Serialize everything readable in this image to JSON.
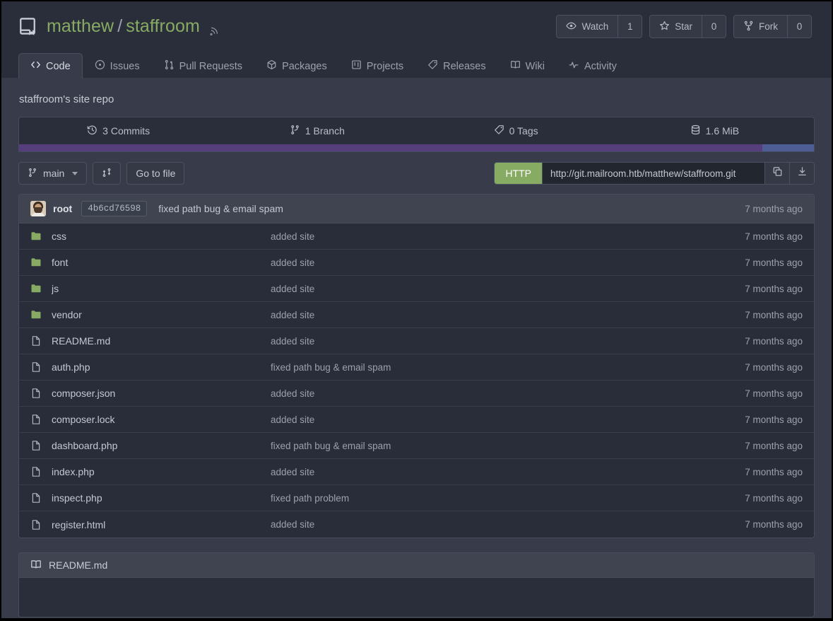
{
  "header": {
    "repo_icon": "repo-book-icon",
    "owner": "matthew",
    "separator": "/",
    "name": "staffroom",
    "rss_icon": "rss-icon",
    "actions": [
      {
        "icon": "eye-icon",
        "label": "Watch",
        "count": "1"
      },
      {
        "icon": "star-icon",
        "label": "Star",
        "count": "0"
      },
      {
        "icon": "fork-icon",
        "label": "Fork",
        "count": "0"
      }
    ]
  },
  "tabs": [
    {
      "id": "code",
      "label": "Code",
      "icon": "code-icon",
      "active": true
    },
    {
      "id": "issues",
      "label": "Issues",
      "icon": "issue-circle-icon",
      "active": false
    },
    {
      "id": "pull-requests",
      "label": "Pull Requests",
      "icon": "git-pull-request-icon",
      "active": false
    },
    {
      "id": "packages",
      "label": "Packages",
      "icon": "package-cube-icon",
      "active": false
    },
    {
      "id": "projects",
      "label": "Projects",
      "icon": "project-board-icon",
      "active": false
    },
    {
      "id": "releases",
      "label": "Releases",
      "icon": "tag-icon",
      "active": false
    },
    {
      "id": "wiki",
      "label": "Wiki",
      "icon": "book-icon",
      "active": false
    },
    {
      "id": "activity",
      "label": "Activity",
      "icon": "pulse-icon",
      "active": false
    }
  ],
  "description": "staffroom's site repo",
  "stats": [
    {
      "icon": "history-clock-icon",
      "label": "3 Commits"
    },
    {
      "icon": "branch-icon",
      "label": "1 Branch"
    },
    {
      "icon": "tag-icon",
      "label": "0 Tags"
    },
    {
      "icon": "database-icon",
      "label": "1.6 MiB"
    }
  ],
  "language_bar": [
    {
      "name": "primary-language",
      "color": "#563d7c",
      "percent": 93.5
    },
    {
      "name": "secondary-language",
      "color": "#4f5d95",
      "percent": 6.5
    }
  ],
  "toolbar": {
    "branch_icon": "branch-icon",
    "branch_label": "main",
    "compare_icon": "git-compare-icon",
    "go_to_file_label": "Go to file",
    "clone": {
      "protocol_label": "HTTP",
      "protocol_color": "#87ab63",
      "url": "http://git.mailroom.htb/matthew/staffroom.git",
      "copy_icon": "copy-icon",
      "download_icon": "download-icon"
    }
  },
  "latest_commit": {
    "avatar": "user-avatar",
    "author": "root",
    "sha": "4b6cd76598",
    "message": "fixed path bug & email spam",
    "age": "7 months ago"
  },
  "files": [
    {
      "type": "folder",
      "icon": "folder-icon",
      "name": "css",
      "message": "added site",
      "age": "7 months ago"
    },
    {
      "type": "folder",
      "icon": "folder-icon",
      "name": "font",
      "message": "added site",
      "age": "7 months ago"
    },
    {
      "type": "folder",
      "icon": "folder-icon",
      "name": "js",
      "message": "added site",
      "age": "7 months ago"
    },
    {
      "type": "folder",
      "icon": "folder-icon",
      "name": "vendor",
      "message": "added site",
      "age": "7 months ago"
    },
    {
      "type": "file",
      "icon": "file-icon",
      "name": "README.md",
      "message": "added site",
      "age": "7 months ago"
    },
    {
      "type": "file",
      "icon": "file-icon",
      "name": "auth.php",
      "message": "fixed path bug & email spam",
      "age": "7 months ago"
    },
    {
      "type": "file",
      "icon": "file-icon",
      "name": "composer.json",
      "message": "added site",
      "age": "7 months ago"
    },
    {
      "type": "file",
      "icon": "file-icon",
      "name": "composer.lock",
      "message": "added site",
      "age": "7 months ago"
    },
    {
      "type": "file",
      "icon": "file-icon",
      "name": "dashboard.php",
      "message": "fixed path bug & email spam",
      "age": "7 months ago"
    },
    {
      "type": "file",
      "icon": "file-icon",
      "name": "index.php",
      "message": "added site",
      "age": "7 months ago"
    },
    {
      "type": "file",
      "icon": "file-icon",
      "name": "inspect.php",
      "message": "fixed path problem",
      "age": "7 months ago"
    },
    {
      "type": "file",
      "icon": "file-icon",
      "name": "register.html",
      "message": "added site",
      "age": "7 months ago"
    }
  ],
  "readme": {
    "icon": "book-icon",
    "title": "README.md",
    "content": ""
  },
  "colors": {
    "page_bg": "#383c4a",
    "panel_bg": "#2a2e3a",
    "row_bg": "#292d39",
    "accent_green": "#87ab63",
    "border": "#474c5c"
  }
}
